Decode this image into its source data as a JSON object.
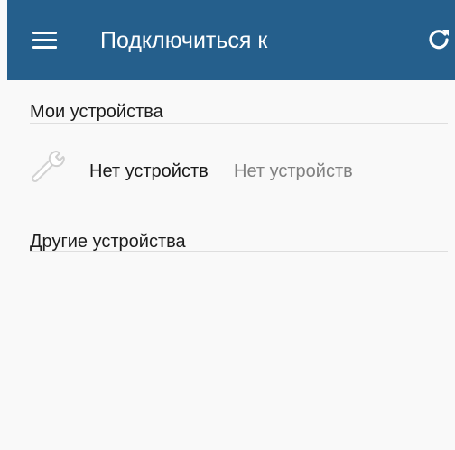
{
  "app_bar": {
    "menu_icon": "hamburger-menu-icon",
    "title": "Подключиться к",
    "refresh_icon": "refresh-icon",
    "color": "#255f8c"
  },
  "sections": {
    "my_devices": {
      "title": "Мои устройства",
      "items": [
        {
          "icon": "wrench-icon",
          "name": "Нет устройств",
          "status": "Нет устройств"
        }
      ]
    },
    "other_devices": {
      "title": "Другие устройства",
      "items": []
    }
  }
}
